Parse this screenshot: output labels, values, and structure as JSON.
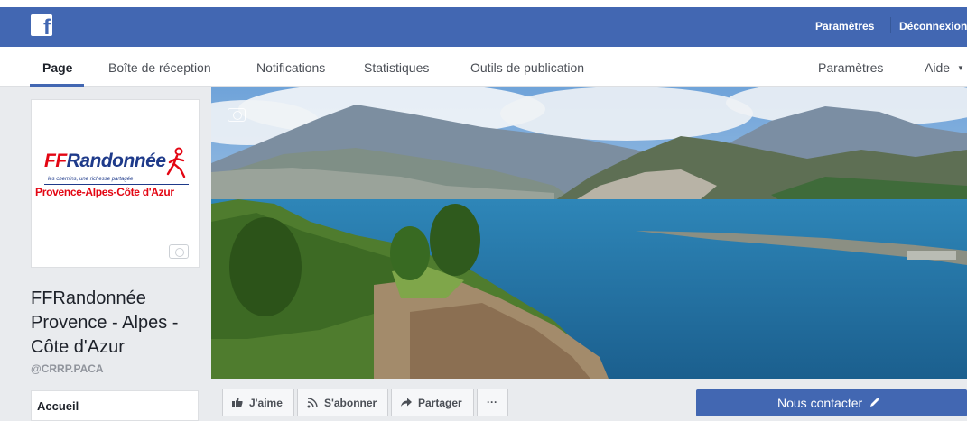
{
  "topbar": {
    "logo": "f",
    "links": [
      "Paramètres",
      "Déconnexion"
    ]
  },
  "tabs": {
    "left": [
      "Page",
      "Boîte de réception",
      "Notifications",
      "Statistiques",
      "Outils de publication"
    ],
    "right": [
      "Paramètres",
      "Aide"
    ],
    "active": "Page"
  },
  "profile": {
    "logo_ff": "FF",
    "logo_randonnee": "Randonnée",
    "logo_tagline": "les chemins, une richesse partagée",
    "logo_region": "Provence-Alpes-Côte d'Azur",
    "name": "FFRandonnée Provence - Alpes - Côte d'Azur",
    "handle": "@CRRP.PACA"
  },
  "left_nav": [
    "Accueil"
  ],
  "actions": {
    "like": "J'aime",
    "follow": "S'abonner",
    "share": "Partager",
    "more": "···",
    "contact": "Nous contacter"
  },
  "colors": {
    "facebook_blue": "#4267b2",
    "logo_red": "#e30613",
    "logo_blue": "#1e3a8a"
  }
}
